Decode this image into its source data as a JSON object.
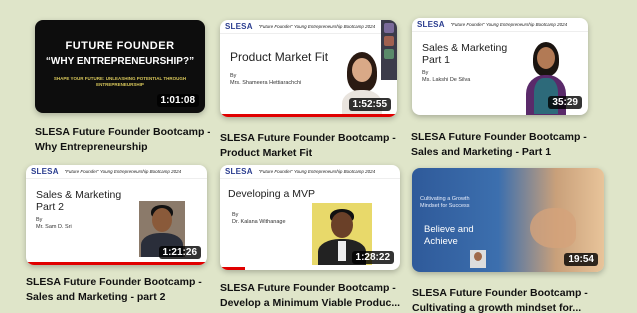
{
  "videos": [
    {
      "title": "SLESA Future Founder Bootcamp -",
      "title2": "Why Entrepreneurship",
      "duration": "1:01:08",
      "thumb": {
        "heading1": "FUTURE FOUNDER",
        "heading2": "“WHY ENTREPRENEURSHIP?”",
        "tagline": "SHAPE YOUR FUTURE: UNLEASHING POTENTIAL THROUGH ENTREPRENEURSHIP"
      }
    },
    {
      "title": "SLESA Future Founder Bootcamp -",
      "title2": "Product Market Fit",
      "duration": "1:52:55",
      "thumb": {
        "logo": "SLESA",
        "tag": "“Future Founder” Young Entrepreneurship Bootcamp 2024",
        "slide_title": "Product Market Fit",
        "by": "By",
        "speaker": "Mrs. Shameera Hettiarachchi"
      }
    },
    {
      "title": "SLESA Future Founder Bootcamp -",
      "title2": "Sales and Marketing - Part 1",
      "duration": "35:29",
      "thumb": {
        "logo": "SLESA",
        "tag": "“Future Founder” Young Entrepreneurship Bootcamp 2024",
        "slide_title1": "Sales & Marketing",
        "slide_title2": "Part 1",
        "by": "By",
        "speaker": "Ms. Lakshi De Silva"
      }
    },
    {
      "title": "SLESA Future Founder Bootcamp -",
      "title2": "Sales and Marketing - part 2",
      "duration": "1:21:26",
      "thumb": {
        "logo": "SLESA",
        "tag": "“Future Founder” Young Entrepreneurship Bootcamp 2024",
        "slide_title1": "Sales & Marketing",
        "slide_title2": "Part 2",
        "by": "By",
        "speaker": "Mr. Sam D. Sri"
      }
    },
    {
      "title": "SLESA Future Founder Bootcamp -",
      "title2": "Develop a Minimum Viable Produc...",
      "duration": "1:28:22",
      "thumb": {
        "logo": "SLESA",
        "tag": "“Future Founder” Young Entrepreneurship Bootcamp 2024",
        "slide_title": "Developing a MVP",
        "by": "By",
        "speaker": "Dr. Kalana Withanage"
      }
    },
    {
      "title": "SLESA Future Founder Bootcamp -",
      "title2": "Cultivating a growth mindset for...",
      "duration": "19:54",
      "thumb": {
        "slide_small": "Cultivating a Growth Mindset for Success",
        "believe": "Believe and",
        "achieve": "Achieve"
      }
    }
  ]
}
